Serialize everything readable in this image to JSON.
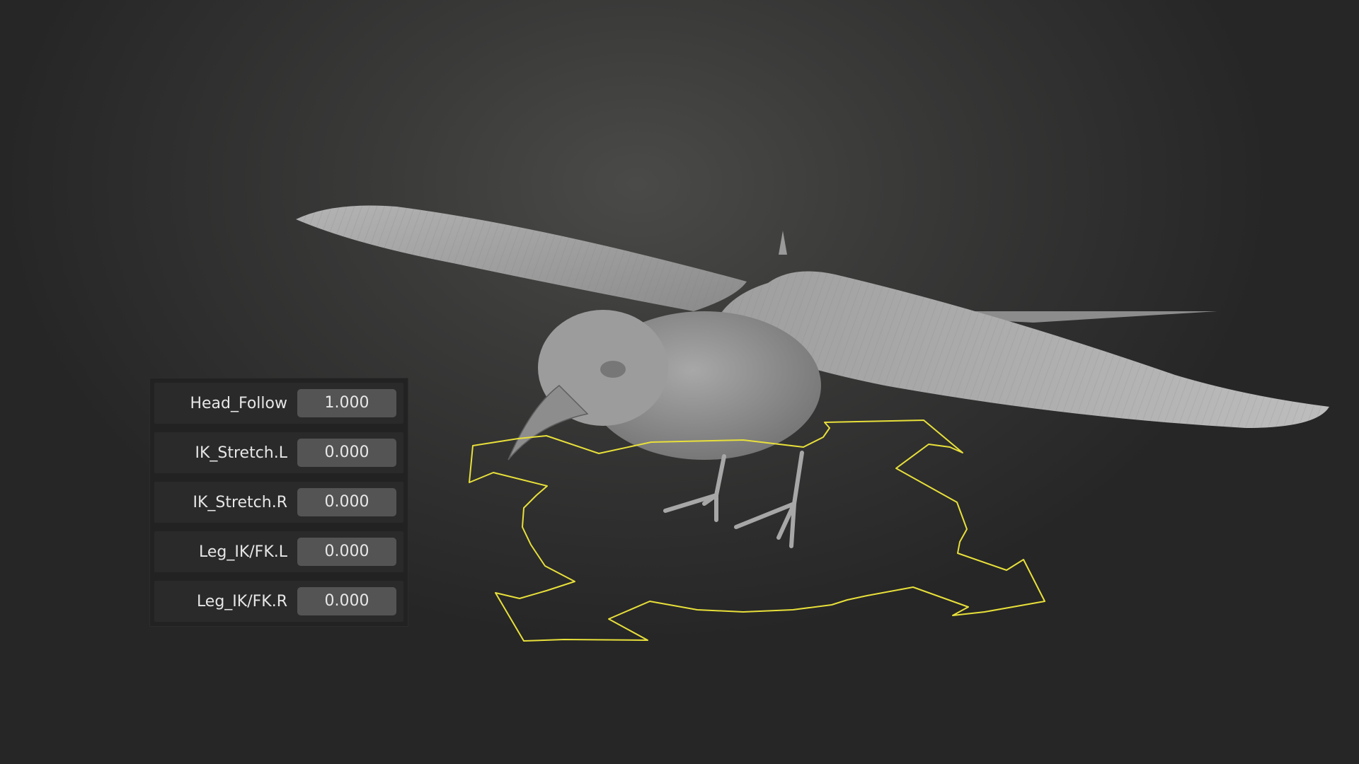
{
  "colors": {
    "background": "#3a3a39",
    "panel": "#222222",
    "field": "#545454",
    "gizmo": "#e8e03a",
    "model": "#9b9b9b"
  },
  "panel": {
    "properties": [
      {
        "label": "Head_Follow",
        "value": "1.000"
      },
      {
        "label": "IK_Stretch.L",
        "value": "0.000"
      },
      {
        "label": "IK_Stretch.R",
        "value": "0.000"
      },
      {
        "label": "Leg_IK/FK.L",
        "value": "0.000"
      },
      {
        "label": "Leg_IK/FK.R",
        "value": "0.000"
      }
    ]
  },
  "viewport": {
    "model": "bird",
    "controller": "root-move-arrows-icon"
  }
}
